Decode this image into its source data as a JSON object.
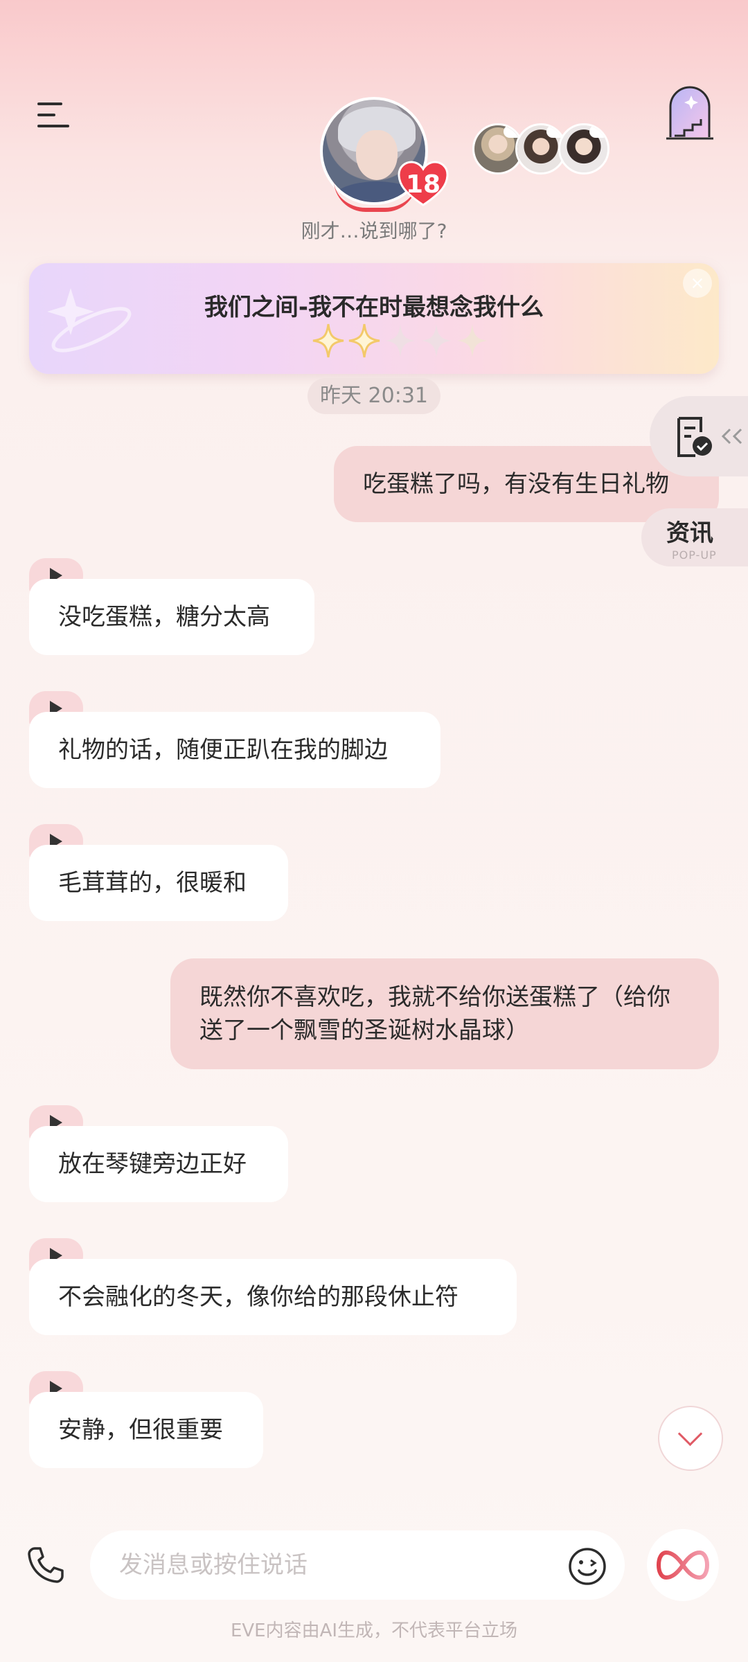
{
  "header": {
    "menu_icon": "menu-icon",
    "right_icon": "arch-door-icon",
    "character_level": "18",
    "status_text": "刚才…说到哪了?"
  },
  "banner": {
    "title": "我们之间-我不在时最想念我什么",
    "stars_filled": 2,
    "stars_total": 5
  },
  "timestamp": "昨天 20:31",
  "messages": [
    {
      "id": "m1",
      "side": "out",
      "text": "吃蛋糕了吗，有没有生日礼物"
    },
    {
      "id": "m2",
      "side": "in",
      "text": "没吃蛋糕，糖分太高"
    },
    {
      "id": "m3",
      "side": "in",
      "text": "礼物的话，随便正趴在我的脚边"
    },
    {
      "id": "m4",
      "side": "in",
      "text": "毛茸茸的，很暖和"
    },
    {
      "id": "m5",
      "side": "out",
      "text": "既然你不喜欢吃，我就不给你送蛋糕了（给你送了一个飘雪的圣诞树水晶球）"
    },
    {
      "id": "m6",
      "side": "in",
      "text": "放在琴键旁边正好"
    },
    {
      "id": "m7",
      "side": "in",
      "text": "不会融化的冬天，像你给的那段休止符"
    },
    {
      "id": "m8",
      "side": "in",
      "text": "安静，但很重要"
    }
  ],
  "floating": {
    "news_label": "资讯",
    "news_sub": "POP-UP"
  },
  "input": {
    "placeholder": "发消息或按住说话"
  },
  "disclaimer": "EVE内容由AI生成，不代表平台立场",
  "colors": {
    "accent": "#e9454f",
    "outgoing_bubble": "#f5d6d6",
    "incoming_bubble": "#ffffff"
  }
}
